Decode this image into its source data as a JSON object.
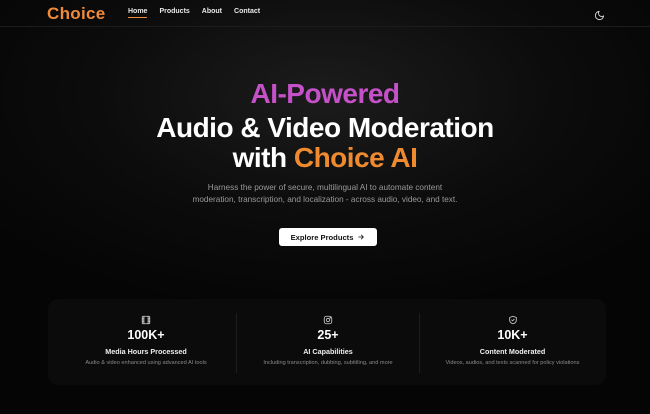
{
  "brand": {
    "logo_text": "Choice",
    "accent": "#f08a3b"
  },
  "nav": {
    "items": [
      {
        "label": "Home",
        "active": true
      },
      {
        "label": "Products",
        "active": false
      },
      {
        "label": "About",
        "active": false
      },
      {
        "label": "Contact",
        "active": false
      }
    ],
    "theme_toggle_icon": "moon-icon"
  },
  "hero": {
    "line1": "AI-Powered",
    "line2": "Audio & Video Moderation",
    "line3_prefix": "with",
    "line3_brand": "Choice AI",
    "subtitle": "Harness the power of secure, multilingual AI to automate content moderation, transcription, and localization - across audio, video, and text.",
    "cta_label": "Explore Products",
    "cta_icon": "arrow-right-icon",
    "colors": {
      "line1": "#c451c7",
      "brand": "#ef8a2f"
    }
  },
  "stats": [
    {
      "icon": "film-icon",
      "value": "100K+",
      "label": "Media Hours Processed",
      "description": "Audio & video enhanced using advanced AI tools"
    },
    {
      "icon": "instagram-icon",
      "value": "25+",
      "label": "AI Capabilities",
      "description": "Including transcription, dubbing, subtitling, and more"
    },
    {
      "icon": "shield-check-icon",
      "value": "10K+",
      "label": "Content Moderated",
      "description": "Videos, audios, and texts scanned for policy violations"
    }
  ]
}
